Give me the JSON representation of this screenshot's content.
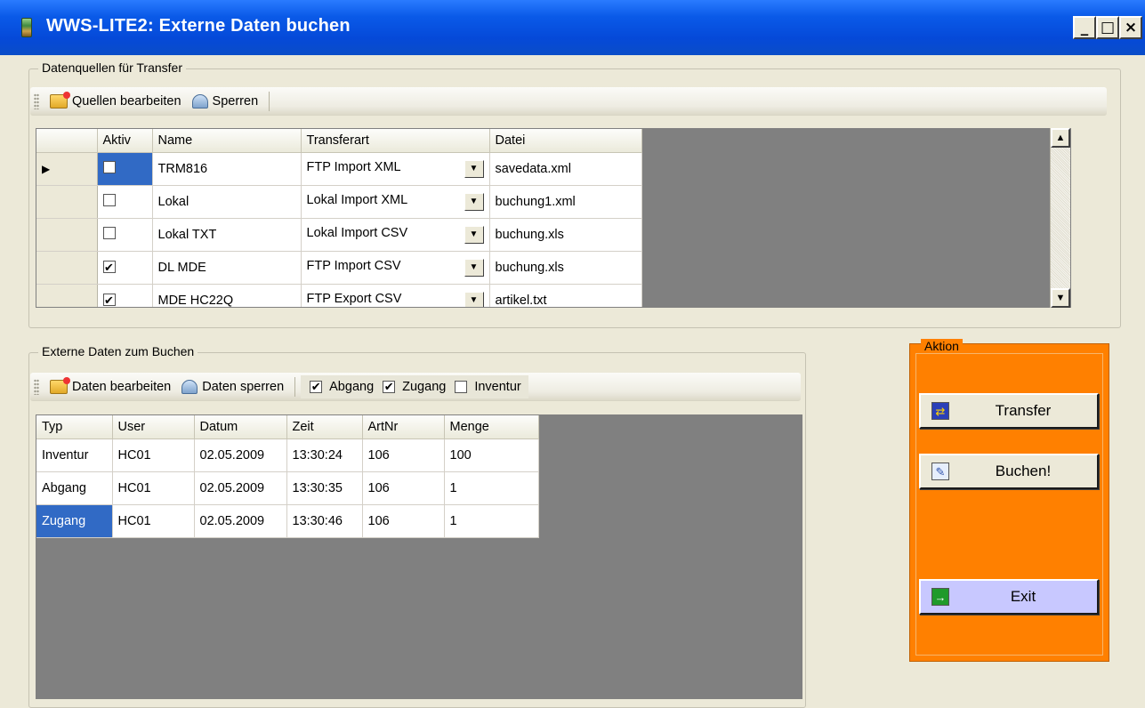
{
  "window": {
    "title": "WWS-LITE2: Externe Daten buchen",
    "btn_min": "_",
    "btn_max": "□",
    "btn_close": "×"
  },
  "sources": {
    "group_label": "Datenquellen für Transfer",
    "toolbar": {
      "edit_label": "Quellen bearbeiten",
      "lock_label": "Sperren"
    },
    "columns": [
      "Aktiv",
      "Name",
      "Transferart",
      "Datei"
    ],
    "rows": [
      {
        "aktiv": false,
        "name": "TRM816",
        "transferart": "FTP Import XML",
        "datei": "savedata.xml"
      },
      {
        "aktiv": false,
        "name": "Lokal",
        "transferart": "Lokal Import XML",
        "datei": "buchung1.xml"
      },
      {
        "aktiv": false,
        "name": "Lokal TXT",
        "transferart": "Lokal Import CSV",
        "datei": "buchung.xls"
      },
      {
        "aktiv": true,
        "name": "DL MDE",
        "transferart": "FTP Import CSV",
        "datei": "buchung.xls"
      },
      {
        "aktiv": true,
        "name": "MDE HC22Q",
        "transferart": "FTP Export CSV",
        "datei": "artikel.txt"
      }
    ]
  },
  "bookings": {
    "group_label": "Externe Daten zum Buchen",
    "toolbar": {
      "edit_label": "Daten bearbeiten",
      "lock_label": "Daten sperren"
    },
    "filters": {
      "abgang_label": "Abgang",
      "zugang_label": "Zugang",
      "inventur_label": "Inventur",
      "abgang": true,
      "zugang": true,
      "inventur": false
    },
    "columns": [
      "Typ",
      "User",
      "Datum",
      "Zeit",
      "ArtNr",
      "Menge"
    ],
    "rows": [
      {
        "typ": "Inventur",
        "user": "HC01",
        "datum": "02.05.2009",
        "zeit": "13:30:24",
        "artnr": "106",
        "menge": "100"
      },
      {
        "typ": "Abgang",
        "user": "HC01",
        "datum": "02.05.2009",
        "zeit": "13:30:35",
        "artnr": "106",
        "menge": "1"
      },
      {
        "typ": "Zugang",
        "user": "HC01",
        "datum": "02.05.2009",
        "zeit": "13:30:46",
        "artnr": "106",
        "menge": "1"
      }
    ]
  },
  "aktion": {
    "group_label": "Aktion",
    "transfer_label": "Transfer",
    "buchen_label": "Buchen!",
    "exit_label": "Exit",
    "panel_color": "#ff8000",
    "exit_color": "#c8c8ff"
  }
}
